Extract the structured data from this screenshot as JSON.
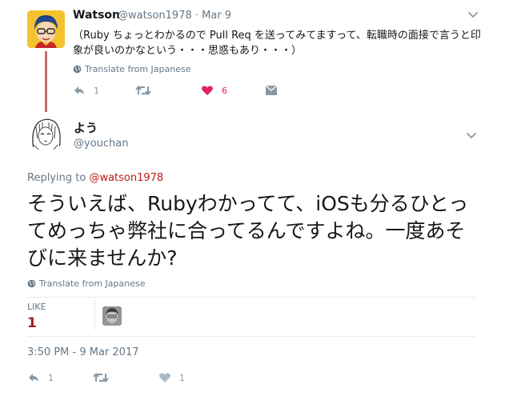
{
  "parent_tweet": {
    "name": "Watson",
    "meta": "@watson1978 · Mar 9",
    "text": "（Ruby ちょっとわかるので Pull Req を送ってみてますって、転職時の面接で言うと印象が良いのかなという・・・思惑もあり・・・）",
    "translate": "Translate from Japanese",
    "reply_count": "1",
    "like_count": "6"
  },
  "main_tweet": {
    "name": "よう",
    "handle": "@youchan",
    "replying_prefix": "Replying to ",
    "replying_to": "@watson1978",
    "text": "そういえば、Rubyわかってて、iOSも分るひとってめっちゃ弊社に合ってるんですよね。一度あそびに来ませんか?",
    "translate": "Translate from Japanese",
    "likes_label": "LIKE",
    "likes_count": "1",
    "timestamp": "3:50 PM - 9 Mar 2017",
    "reply_count": "1",
    "like_count": "1"
  },
  "colors": {
    "like_active": "#e0245e",
    "mention": "#b91c1c",
    "thread_line": "#c96a6a",
    "muted": "#657786"
  },
  "icons": [
    "globe-icon",
    "reply-icon",
    "retweet-icon",
    "heart-icon",
    "dm-icon",
    "chevron-down-icon"
  ]
}
